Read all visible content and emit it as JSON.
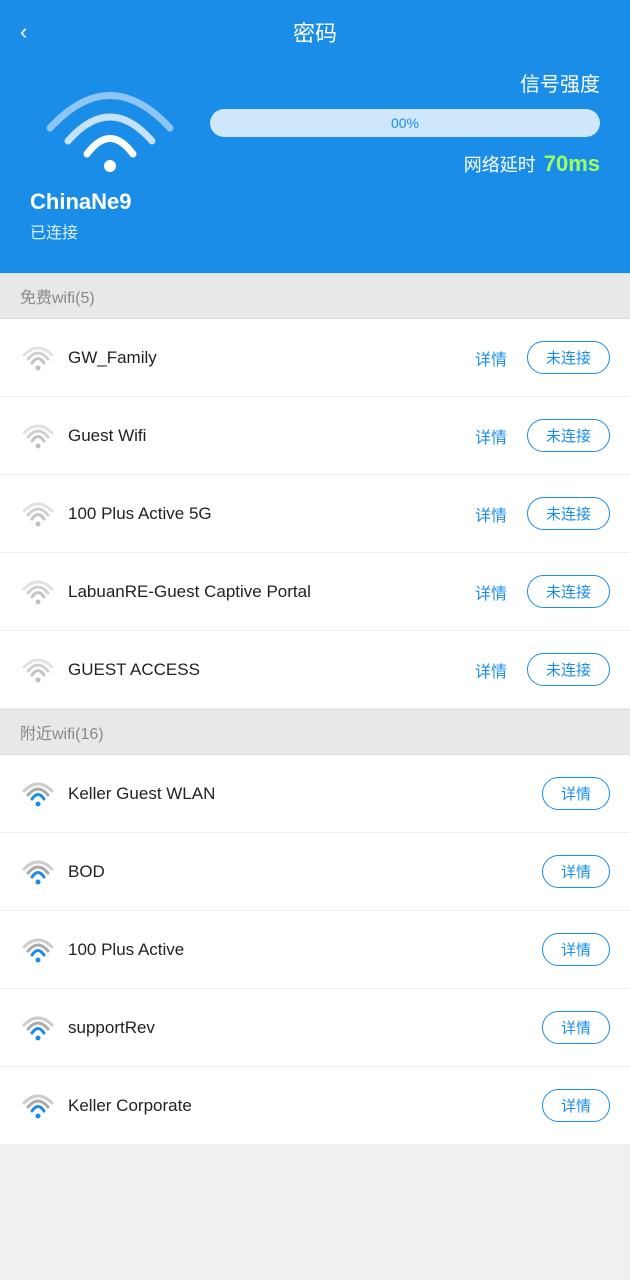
{
  "header": {
    "title": "密码",
    "back_label": "‹",
    "signal_label": "信号强度",
    "progress_value": "00%",
    "progress_percent": 0,
    "latency_label": "网络延时",
    "latency_value": "70ms",
    "network_name": "ChinaNe9",
    "connected_label": "已连接"
  },
  "free_wifi_section": {
    "label": "免费wifi(5)",
    "items": [
      {
        "name": "GW_Family",
        "detail": "详情",
        "action": "未连接"
      },
      {
        "name": "Guest Wifi",
        "detail": "详情",
        "action": "未连接"
      },
      {
        "name": "100 Plus Active 5G",
        "detail": "详情",
        "action": "未连接"
      },
      {
        "name": "LabuanRE-Guest Captive Portal",
        "detail": "详情",
        "action": "未连接"
      },
      {
        "name": "GUEST ACCESS",
        "detail": "详情",
        "action": "未连接"
      }
    ]
  },
  "nearby_wifi_section": {
    "label": "附近wifi(16)",
    "items": [
      {
        "name": "Keller Guest WLAN",
        "detail": "详情"
      },
      {
        "name": "BOD",
        "detail": "详情"
      },
      {
        "name": "100 Plus Active",
        "detail": "详情"
      },
      {
        "name": "supportRev",
        "detail": "详情"
      },
      {
        "name": "Keller Corporate",
        "detail": "详情"
      }
    ]
  }
}
